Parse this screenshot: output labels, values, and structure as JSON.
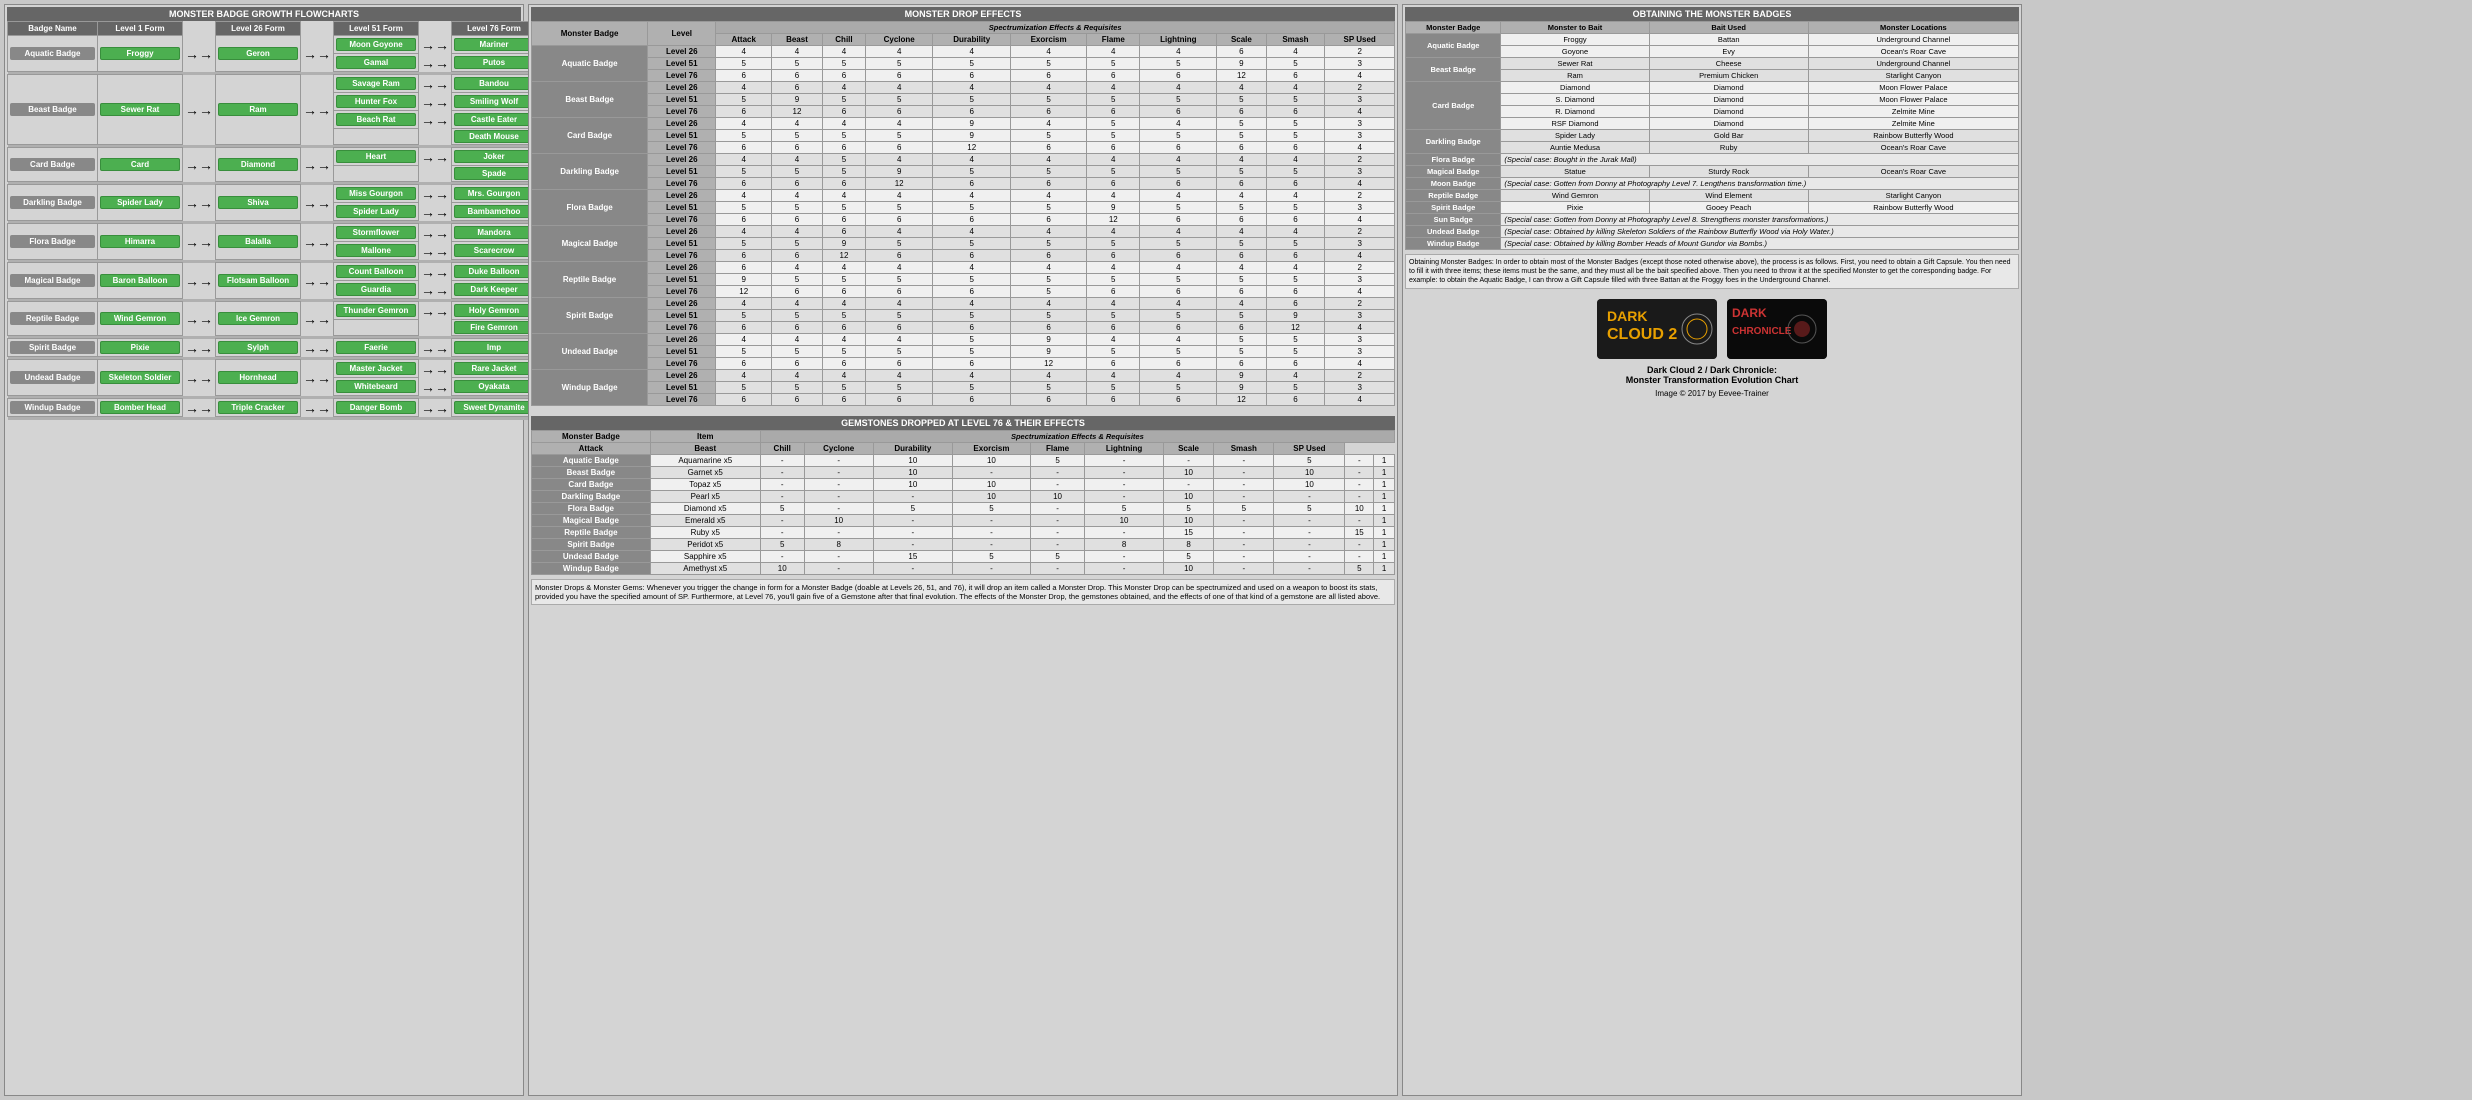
{
  "flowchart": {
    "title": "MONSTER BADGE GROWTH FLOWCHARTS",
    "headers": [
      "Badge Name",
      "Level 1 Form",
      "Level 26 Form",
      "Level 51 Form",
      "Level 76 Form"
    ],
    "rows": [
      {
        "badge": "Aquatic Badge",
        "l1": [
          "Froggy"
        ],
        "l26": [
          "Geron"
        ],
        "l51": [
          "Moon Goyone",
          "Gamal"
        ],
        "l76": [
          "Mariner",
          "Putos"
        ]
      },
      {
        "badge": "Beast Badge",
        "l1": [
          "Sewer Rat"
        ],
        "l26": [
          "Ram"
        ],
        "l51": [
          "Savage Ram",
          "Hunter Fox",
          "Beach Rat"
        ],
        "l76": [
          "Bandou",
          "Smiling Wolf",
          "Castle Eater",
          "Death Mouse"
        ]
      },
      {
        "badge": "Card Badge",
        "l1": [
          "Card"
        ],
        "l26": [
          "Diamond"
        ],
        "l51": [
          "Heart"
        ],
        "l76": [
          "Joker",
          "Spade"
        ]
      },
      {
        "badge": "Darkling Badge",
        "l1": [
          "Spider Lady"
        ],
        "l26": [
          "Shiva"
        ],
        "l51": [
          "Miss Gourgon",
          "Spider Lady"
        ],
        "l76": [
          "Mrs. Gourgon",
          "Bambamchoo"
        ]
      },
      {
        "badge": "Flora Badge",
        "l1": [
          "Himarra"
        ],
        "l26": [
          "Balalla"
        ],
        "l51": [
          "Stormflower",
          "Mallone"
        ],
        "l76": [
          "Mandora",
          "Scarecrow"
        ]
      },
      {
        "badge": "Magical Badge",
        "l1": [
          "Baron Balloon"
        ],
        "l26": [
          "Flotsam Balloon"
        ],
        "l51": [
          "Count Balloon",
          "Guardia"
        ],
        "l76": [
          "Duke Balloon",
          "Dark Keeper"
        ]
      },
      {
        "badge": "Reptile Badge",
        "l1": [
          "Wind Gemron"
        ],
        "l26": [
          "Ice Gemron"
        ],
        "l51": [
          "Thunder Gemron"
        ],
        "l76": [
          "Holy Gemron",
          "Fire Gemron"
        ]
      },
      {
        "badge": "Spirit Badge",
        "l1": [
          "Pixie"
        ],
        "l26": [
          "Sylph"
        ],
        "l51": [
          "Faerie"
        ],
        "l76": [
          "Imp"
        ]
      },
      {
        "badge": "Undead Badge",
        "l1": [
          "Skeleton Soldier"
        ],
        "l26": [
          "Hornhead"
        ],
        "l51": [
          "Master Jacket",
          "Whitebeard"
        ],
        "l76": [
          "Rare Jacket",
          "Oyakata"
        ]
      },
      {
        "badge": "Windup Badge",
        "l1": [
          "Bomber Head"
        ],
        "l26": [
          "Triple Cracker"
        ],
        "l51": [
          "Danger Bomb"
        ],
        "l76": [
          "Sweet Dynamite"
        ]
      }
    ]
  },
  "drop_effects": {
    "title": "MONSTER DROP EFFECTS",
    "sub_title": "Spectrumization Effects & Requisites",
    "headers": [
      "Monster Badge",
      "Level",
      "Attack",
      "Beast",
      "Chill",
      "Cyclone",
      "Durability",
      "Exorcism",
      "Flame",
      "Lightning",
      "Scale",
      "Smash",
      "SP Used"
    ],
    "rows": [
      {
        "badge": "Aquatic Badge",
        "levels": [
          [
            "Level 26",
            "4",
            "4",
            "4",
            "4",
            "4",
            "4",
            "4",
            "4",
            "6",
            "4",
            "2"
          ],
          [
            "Level 51",
            "5",
            "5",
            "5",
            "5",
            "5",
            "5",
            "5",
            "5",
            "9",
            "5",
            "3"
          ],
          [
            "Level 76",
            "6",
            "6",
            "6",
            "6",
            "6",
            "6",
            "6",
            "6",
            "12",
            "6",
            "4"
          ]
        ]
      },
      {
        "badge": "Beast Badge",
        "levels": [
          [
            "Level 26",
            "4",
            "6",
            "4",
            "4",
            "4",
            "4",
            "4",
            "4",
            "4",
            "4",
            "2"
          ],
          [
            "Level 51",
            "5",
            "9",
            "5",
            "5",
            "5",
            "5",
            "5",
            "5",
            "5",
            "5",
            "3"
          ],
          [
            "Level 76",
            "6",
            "12",
            "6",
            "6",
            "6",
            "6",
            "6",
            "6",
            "6",
            "6",
            "4"
          ]
        ]
      },
      {
        "badge": "Card Badge",
        "levels": [
          [
            "Level 26",
            "4",
            "4",
            "4",
            "4",
            "9",
            "4",
            "5",
            "4",
            "5",
            "5",
            "3"
          ],
          [
            "Level 51",
            "5",
            "5",
            "5",
            "5",
            "9",
            "5",
            "5",
            "5",
            "5",
            "5",
            "3"
          ],
          [
            "Level 76",
            "6",
            "6",
            "6",
            "6",
            "12",
            "6",
            "6",
            "6",
            "6",
            "6",
            "4"
          ]
        ]
      },
      {
        "badge": "Darkling Badge",
        "levels": [
          [
            "Level 26",
            "4",
            "4",
            "5",
            "4",
            "4",
            "4",
            "4",
            "4",
            "4",
            "4",
            "2"
          ],
          [
            "Level 51",
            "5",
            "5",
            "5",
            "9",
            "5",
            "5",
            "5",
            "5",
            "5",
            "5",
            "3"
          ],
          [
            "Level 76",
            "6",
            "6",
            "6",
            "12",
            "6",
            "6",
            "6",
            "6",
            "6",
            "6",
            "4"
          ]
        ]
      },
      {
        "badge": "Flora Badge",
        "levels": [
          [
            "Level 26",
            "4",
            "4",
            "4",
            "4",
            "4",
            "4",
            "4",
            "4",
            "4",
            "4",
            "2"
          ],
          [
            "Level 51",
            "5",
            "5",
            "5",
            "5",
            "5",
            "5",
            "9",
            "5",
            "5",
            "5",
            "3"
          ],
          [
            "Level 76",
            "6",
            "6",
            "6",
            "6",
            "6",
            "6",
            "12",
            "6",
            "6",
            "6",
            "4"
          ]
        ]
      },
      {
        "badge": "Magical Badge",
        "levels": [
          [
            "Level 26",
            "4",
            "4",
            "6",
            "4",
            "4",
            "4",
            "4",
            "4",
            "4",
            "4",
            "2"
          ],
          [
            "Level 51",
            "5",
            "5",
            "9",
            "5",
            "5",
            "5",
            "5",
            "5",
            "5",
            "5",
            "3"
          ],
          [
            "Level 76",
            "6",
            "6",
            "12",
            "6",
            "6",
            "6",
            "6",
            "6",
            "6",
            "6",
            "4"
          ]
        ]
      },
      {
        "badge": "Reptile Badge",
        "levels": [
          [
            "Level 26",
            "6",
            "4",
            "4",
            "4",
            "4",
            "4",
            "4",
            "4",
            "4",
            "4",
            "2"
          ],
          [
            "Level 51",
            "9",
            "5",
            "5",
            "5",
            "5",
            "5",
            "5",
            "5",
            "5",
            "5",
            "3"
          ],
          [
            "Level 76",
            "12",
            "6",
            "6",
            "6",
            "6",
            "5",
            "6",
            "6",
            "6",
            "6",
            "4"
          ]
        ]
      },
      {
        "badge": "Spirit Badge",
        "levels": [
          [
            "Level 26",
            "4",
            "4",
            "4",
            "4",
            "4",
            "4",
            "4",
            "4",
            "4",
            "6",
            "2"
          ],
          [
            "Level 51",
            "5",
            "5",
            "5",
            "5",
            "5",
            "5",
            "5",
            "5",
            "5",
            "9",
            "3"
          ],
          [
            "Level 76",
            "6",
            "6",
            "6",
            "6",
            "6",
            "6",
            "6",
            "6",
            "6",
            "12",
            "4"
          ]
        ]
      },
      {
        "badge": "Undead Badge",
        "levels": [
          [
            "Level 26",
            "4",
            "4",
            "4",
            "4",
            "5",
            "9",
            "4",
            "4",
            "5",
            "5",
            "3"
          ],
          [
            "Level 51",
            "5",
            "5",
            "5",
            "5",
            "5",
            "9",
            "5",
            "5",
            "5",
            "5",
            "3"
          ],
          [
            "Level 76",
            "6",
            "6",
            "6",
            "6",
            "6",
            "12",
            "6",
            "6",
            "6",
            "6",
            "4"
          ]
        ]
      },
      {
        "badge": "Windup Badge",
        "levels": [
          [
            "Level 26",
            "4",
            "4",
            "4",
            "4",
            "4",
            "4",
            "4",
            "4",
            "9",
            "4",
            "2"
          ],
          [
            "Level 51",
            "5",
            "5",
            "5",
            "5",
            "5",
            "5",
            "5",
            "5",
            "9",
            "5",
            "3"
          ],
          [
            "Level 76",
            "6",
            "6",
            "6",
            "6",
            "6",
            "6",
            "6",
            "6",
            "12",
            "6",
            "4"
          ]
        ]
      }
    ]
  },
  "gemstones": {
    "title": "GEMSTONES DROPPED AT LEVEL 76 & THEIR EFFECTS",
    "sub_title": "Spectrumization Effects & Requisites",
    "headers": [
      "Monster Badge",
      "Item",
      "Attack",
      "Beast",
      "Chill",
      "Cyclone",
      "Durability",
      "Exorcism",
      "Flame",
      "Lightning",
      "Scale",
      "Smash",
      "SP Used"
    ],
    "rows": [
      [
        "Aquatic Badge",
        "Aquamarine x5",
        "-",
        "-",
        "10",
        "10",
        "5",
        "-",
        "-",
        "-",
        "5",
        "-",
        "1"
      ],
      [
        "Beast Badge",
        "Garnet x5",
        "-",
        "-",
        "10",
        "-",
        "-",
        "-",
        "10",
        "-",
        "10",
        "-",
        "1"
      ],
      [
        "Card Badge",
        "Topaz x5",
        "-",
        "-",
        "10",
        "10",
        "-",
        "-",
        "-",
        "-",
        "10",
        "-",
        "1"
      ],
      [
        "Darkling Badge",
        "Pearl x5",
        "-",
        "-",
        "-",
        "10",
        "10",
        "-",
        "10",
        "-",
        "-",
        "-",
        "1"
      ],
      [
        "Flora Badge",
        "Diamond x5",
        "5",
        "-",
        "5",
        "5",
        "-",
        "5",
        "5",
        "5",
        "5",
        "10",
        "1"
      ],
      [
        "Magical Badge",
        "Emerald x5",
        "-",
        "10",
        "-",
        "-",
        "-",
        "10",
        "10",
        "-",
        "-",
        "-",
        "1"
      ],
      [
        "Reptile Badge",
        "Ruby x5",
        "-",
        "-",
        "-",
        "-",
        "-",
        "-",
        "15",
        "-",
        "-",
        "15",
        "1"
      ],
      [
        "Spirit Badge",
        "Peridot x5",
        "5",
        "8",
        "-",
        "-",
        "-",
        "8",
        "8",
        "-",
        "-",
        "-",
        "1"
      ],
      [
        "Undead Badge",
        "Sapphire x5",
        "-",
        "-",
        "15",
        "5",
        "5",
        "-",
        "5",
        "-",
        "-",
        "-",
        "1"
      ],
      [
        "Windup Badge",
        "Amethyst x5",
        "10",
        "-",
        "-",
        "-",
        "-",
        "-",
        "10",
        "-",
        "-",
        "5",
        "1"
      ]
    ]
  },
  "monster_drops_note": "Monster Drops & Monster Gems: Whenever you trigger the change in form for a Monster Badge (doable at Levels 26, 51, and 76), it will drop an item called a Monster Drop. This Monster Drop can be spectrumized and used on a weapon to boost its stats, provided you have the specified amount of SP. Furthermore, at Level 76, you'll gain five of a Gemstone after that final evolution. The effects of the Monster Drop, the gemstones obtained, and the effects of one of that kind of a gemstone are all listed above.",
  "obtaining": {
    "title": "OBTAINING THE MONSTER BADGES",
    "headers": [
      "Monster Badge",
      "Monster to Bait",
      "Bait Used",
      "Monster Locations"
    ],
    "rows": [
      {
        "badge": "Aquatic Badge",
        "entries": [
          [
            "Froggy",
            "Battan",
            "Underground Channel"
          ],
          [
            "Goyone",
            "Evy",
            "Ocean's Roar Cave"
          ]
        ]
      },
      {
        "badge": "Beast Badge",
        "entries": [
          [
            "Sewer Rat",
            "Cheese",
            "Underground Channel"
          ],
          [
            "Ram",
            "Premium Chicken",
            "Starlight Canyon"
          ]
        ]
      },
      {
        "badge": "Card Badge",
        "entries": [
          [
            "Diamond",
            "Diamond",
            "Moon Flower Palace"
          ],
          [
            "S. Diamond",
            "Diamond",
            "Moon Flower Palace"
          ],
          [
            "R. Diamond",
            "Diamond",
            "Zelmite Mine"
          ],
          [
            "RSF Diamond",
            "Diamond",
            "Zelmite Mine"
          ]
        ]
      },
      {
        "badge": "Darkling Badge",
        "entries": [
          [
            "Spider Lady",
            "Gold Bar",
            "Rainbow Butterfly Wood"
          ],
          [
            "Auntie Medusa",
            "Ruby",
            "Ocean's Roar Cave"
          ]
        ]
      },
      {
        "badge": "Flora Badge",
        "special": "(Special case: Bought in the Jurak Mall)"
      },
      {
        "badge": "Magical Badge",
        "entries": [
          [
            "Statue",
            "Sturdy Rock",
            "Ocean's Roar Cave"
          ]
        ]
      },
      {
        "badge": "Moon Badge",
        "special": "(Special case: Gotten from Donny at Photography Level 7. Lengthens transformation time.)"
      },
      {
        "badge": "Reptile Badge",
        "entries": [
          [
            "Wind Gemron",
            "Wind Element",
            "Starlight Canyon"
          ]
        ]
      },
      {
        "badge": "Spirit Badge",
        "entries": [
          [
            "Pixie",
            "Gooey Peach",
            "Rainbow Butterfly Wood"
          ]
        ]
      },
      {
        "badge": "Sun Badge",
        "special": "(Special case: Gotten from Donny at Photography Level 8. Strengthens monster transformations.)"
      },
      {
        "badge": "Undead Badge",
        "special": "(Special case: Obtained by killing Skeleton Soldiers of the Rainbow Butterfly Wood via Holy Water.)"
      },
      {
        "badge": "Windup Badge",
        "special": "(Special case: Obtained by killing Bomber Heads of Mount Gundor via Bombs.)"
      }
    ],
    "obtain_text": "Obtaining Monster Badges: In order to obtain most of the Monster Badges (except those noted otherwise above), the process is as follows. First, you need to obtain a Gift Capsule. You then need to fill it with three items; these items must be the same, and they must all be the bait specified above. Then you need to throw it at the specified Monster to get the corresponding badge. For example: to obtain the Aquatic Badge, I can throw a Gift Capsule filled with three Battan at the Froggy foes in the Underground Channel."
  },
  "credits": {
    "title": "Dark Cloud 2 / Dark Chronicle:",
    "subtitle": "Monster Transformation Evolution Chart",
    "copyright": "Image © 2017 by Eevee-Trainer"
  }
}
